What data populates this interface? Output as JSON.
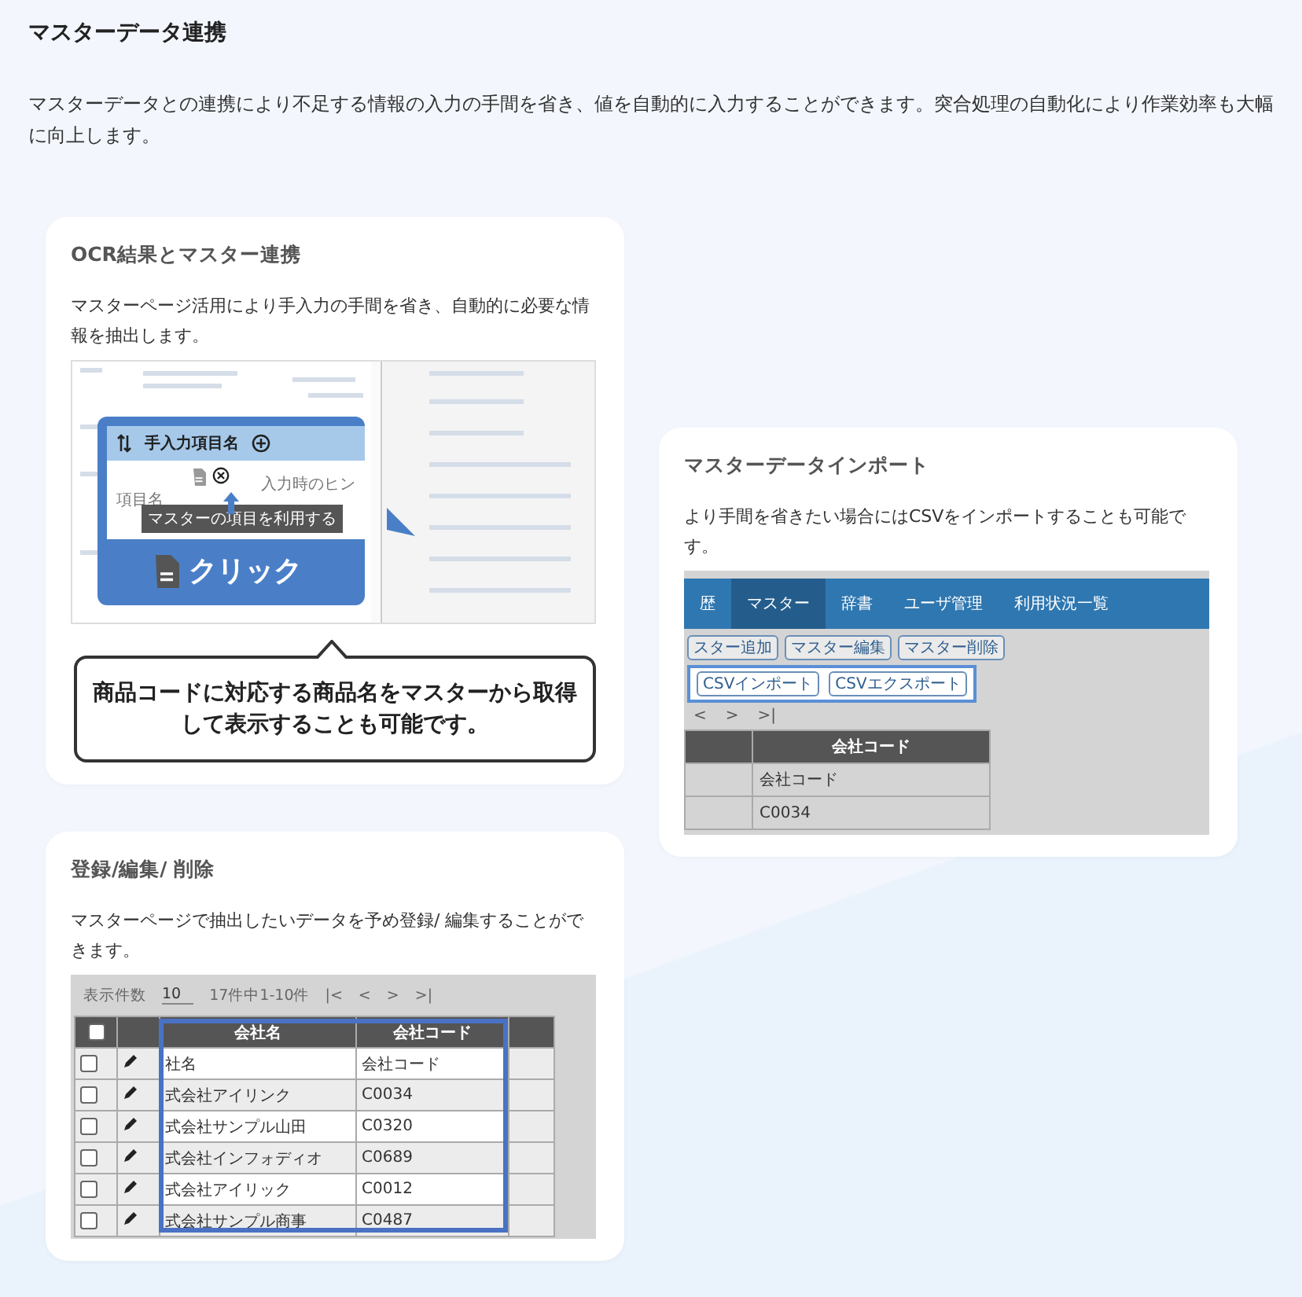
{
  "page": {
    "title": "マスターデータ連携",
    "description": "マスターデータとの連携により不足する情報の入力の手間を省き、値を自動的に入力することができます。突合処理の自動化により作業効率も大幅に向上します。"
  },
  "cards": [
    {
      "kind": "ocr",
      "title": "OCR結果とマスター連携",
      "description": "マスターページ活用により手入力の手間を省き、自動的に必要な情報を抽出します。",
      "screenshot": {
        "panel_title": "手入力項目名",
        "field_label": "項目名",
        "hint_label": "入力時のヒン",
        "tooltip": "マスターの項目を利用する",
        "action": "クリック"
      },
      "callout": "商品コードに対応する商品名をマスターから取得して表示することも可能です。"
    },
    {
      "kind": "import",
      "title": "マスターデータインポート",
      "description": "より手間を省きたい場合にはCSVをインポートすることも可能です。",
      "screenshot": {
        "nav": [
          {
            "label": "歴",
            "selected": false
          },
          {
            "label": "マスター",
            "selected": true
          },
          {
            "label": "辞書",
            "selected": false
          },
          {
            "label": "ユーザ管理",
            "selected": false
          },
          {
            "label": "利用状況一覧",
            "selected": false
          }
        ],
        "buttons": [
          {
            "label": "スター追加",
            "highlighted": false
          },
          {
            "label": "マスター編集",
            "highlighted": false
          },
          {
            "label": "マスター削除",
            "highlighted": false
          },
          {
            "label": "CSVインポート",
            "highlighted": true
          },
          {
            "label": "CSVエクスポート",
            "highlighted": true
          }
        ],
        "pager": [
          "<",
          ">",
          ">|"
        ],
        "column": "会社コード",
        "rows": [
          "会社コード",
          "C0034"
        ]
      }
    },
    {
      "kind": "list",
      "title": "登録/編集/ 削除",
      "description": "マスターページで抽出したいデータを予め登録/ 編集することができます。",
      "screenshot": {
        "page_size_label": "表示件数",
        "page_size": "10",
        "range": "17件中1-10件",
        "pager": [
          "|<",
          "<",
          ">",
          ">|"
        ],
        "select_all_checked": false,
        "columns": [
          "会社名",
          "会社コード"
        ],
        "rows": [
          {
            "name": "社名",
            "code": "会社コード",
            "checked": false
          },
          {
            "name": "式会社アイリンク",
            "code": "C0034",
            "checked": false
          },
          {
            "name": "式会社サンプル山田",
            "code": "C0320",
            "checked": false
          },
          {
            "name": "式会社インフォディオ",
            "code": "C0689",
            "checked": false
          },
          {
            "name": "式会社アイリック",
            "code": "C0012",
            "checked": false
          },
          {
            "name": "式会社サンプル商事",
            "code": "C0487",
            "checked": false
          }
        ]
      }
    }
  ]
}
